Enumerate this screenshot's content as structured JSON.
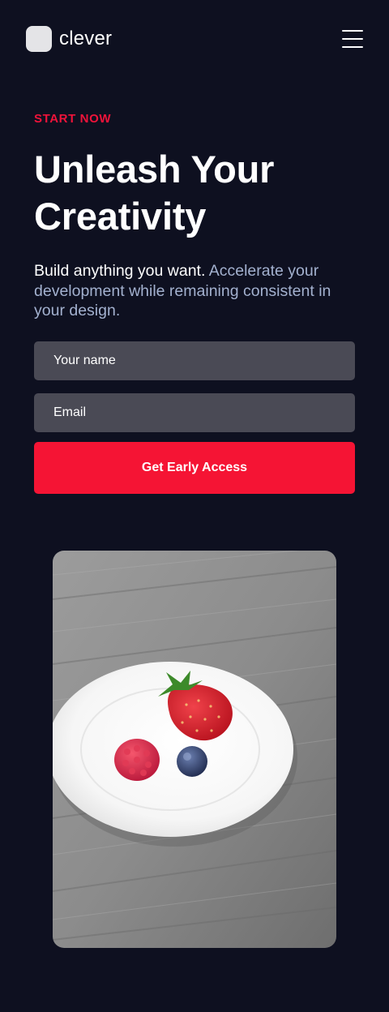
{
  "header": {
    "brand_name": "clever",
    "logo_icon": "rounded-square-logo",
    "menu_icon": "hamburger-icon"
  },
  "hero": {
    "eyebrow": "START NOW",
    "headline_line1": "Unleash Your",
    "headline_line2": "Creativity",
    "lead_strong": "Build anything you want.",
    "lead_muted": "Accelerate your development while remaining consistent in your design."
  },
  "form": {
    "name_placeholder": "Your name",
    "email_placeholder": "Email",
    "submit_label": "Get Early Access"
  },
  "image": {
    "alt": "Strawberry, raspberry and blueberry on a white plate on a wooden table"
  },
  "colors": {
    "background": "#0e1020",
    "accent": "#f51434",
    "muted_text": "#a3b1cf",
    "input_background": "#4a4a55"
  }
}
